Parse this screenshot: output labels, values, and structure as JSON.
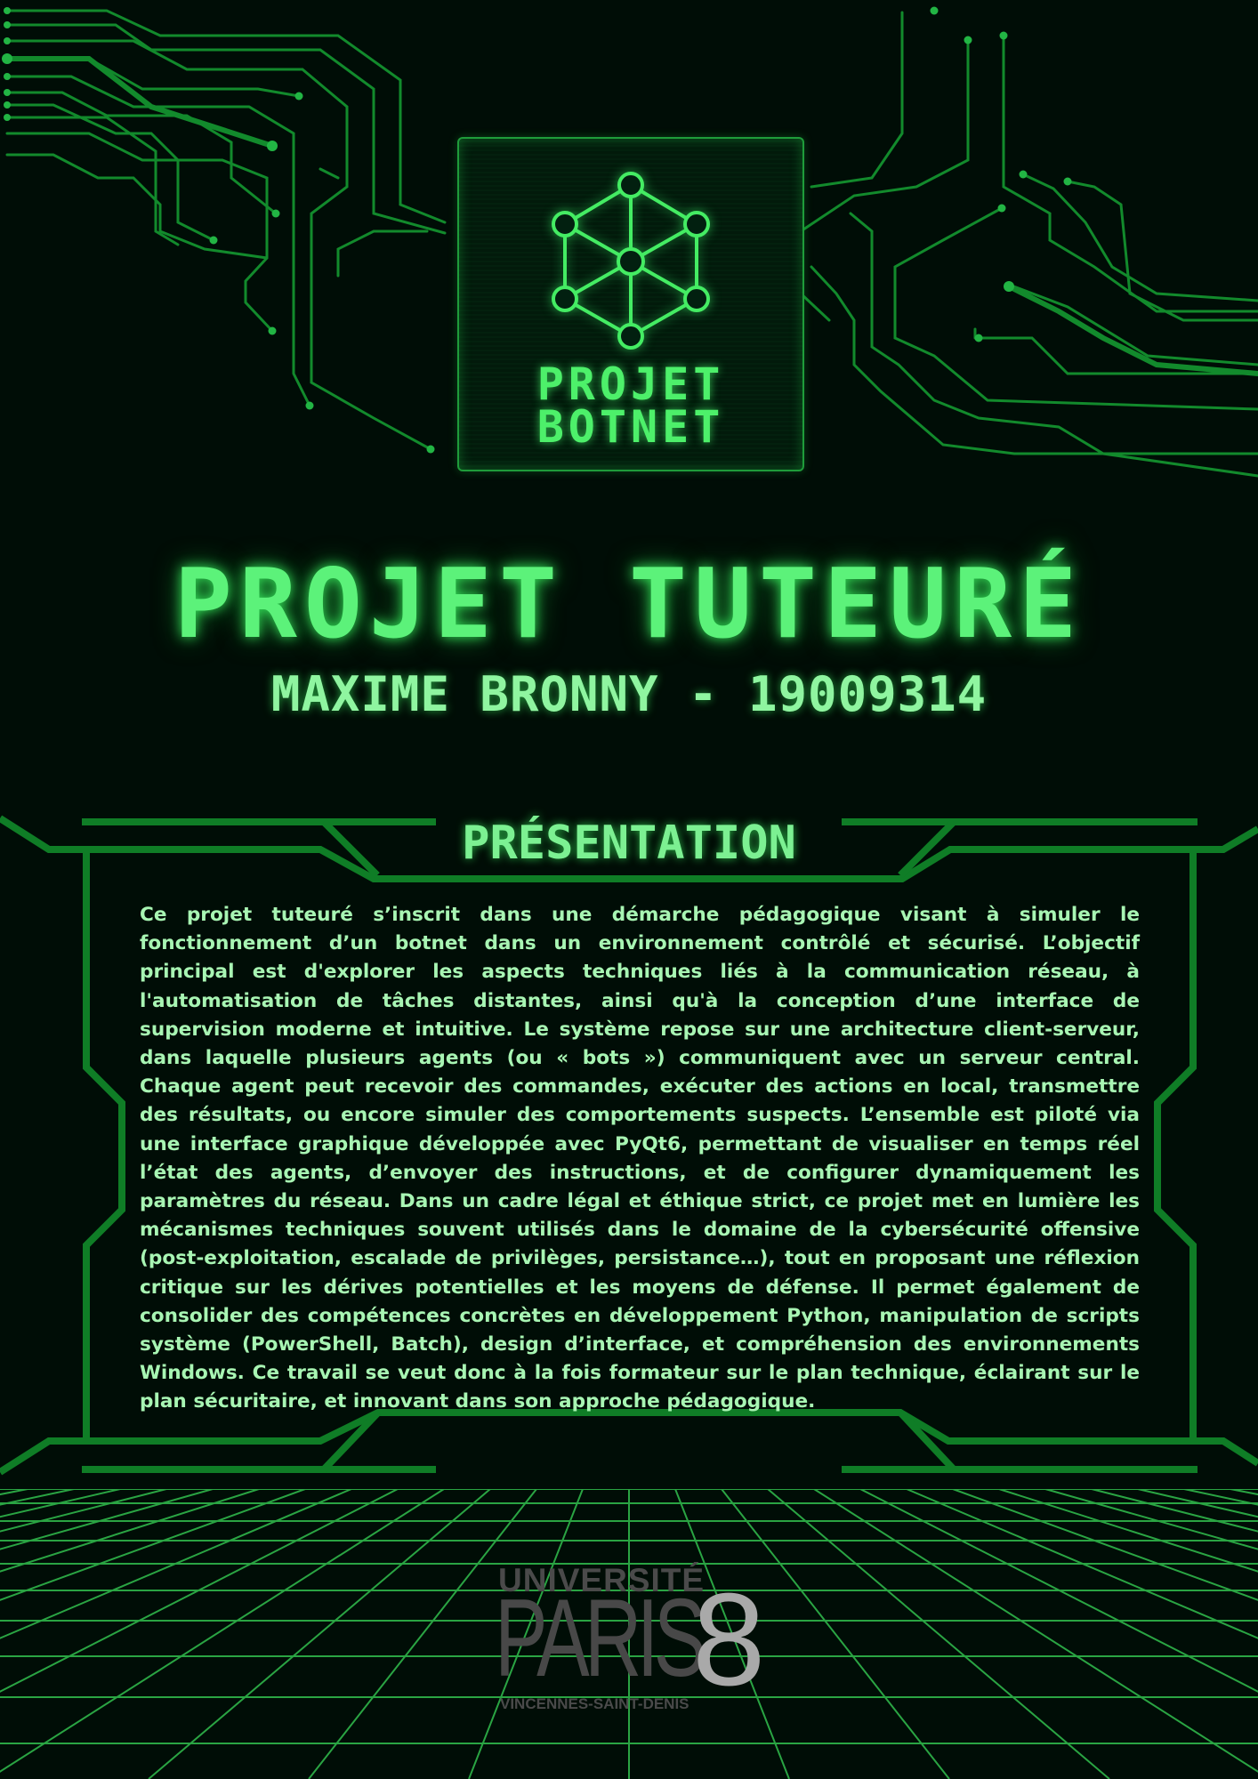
{
  "colors": {
    "background": "#000d06",
    "circuit": "#128a2c",
    "neon": "#5cf27a",
    "text": "#a8f5b3",
    "grid": "#2fb54a",
    "logo_gray": "#484848",
    "logo_light": "#a9a9a9"
  },
  "logo": {
    "icon": "network-hexagon-icon",
    "line1": "PROJET",
    "line2": "BOTNET"
  },
  "header": {
    "title": "PROJET TUTEURÉ",
    "subtitle": "MAXIME BRONNY - 19009314"
  },
  "presentation": {
    "heading": "PRÉSENTATION",
    "body": "Ce projet tuteuré s’inscrit dans une démarche pédagogique visant à simuler le fonctionnement d’un botnet dans un environnement contrôlé et sécurisé. L’objectif principal est d'explorer les aspects techniques liés à la communication réseau, à l'automatisation de tâches distantes, ainsi qu'à la conception d’une interface de supervision moderne et intuitive. Le système repose sur une architecture client-serveur, dans laquelle plusieurs agents (ou « bots ») communiquent avec un serveur central. Chaque agent peut recevoir des commandes, exécuter des actions en local, transmettre des résultats, ou encore simuler des comportements suspects. L’ensemble est piloté via une interface graphique développée avec PyQt6, permettant de visualiser en temps réel l’état des agents, d’envoyer des instructions, et de configurer dynamiquement les paramètres du réseau. Dans un cadre légal et éthique strict, ce projet met en lumière les mécanismes techniques souvent utilisés dans le domaine de la cybersécurité offensive (post-exploitation, escalade de privilèges, persistance…), tout en proposant une réflexion critique sur les dérives potentielles et les moyens de défense. Il permet également de consolider des compétences concrètes en développement Python, manipulation de scripts système (PowerShell, Batch), design d’interface, et compréhension des environnements Windows. Ce travail se veut donc à la fois formateur sur le plan technique, éclairant sur le plan sécuritaire, et innovant dans son approche pédagogique."
  },
  "university": {
    "top": "UNIVERSITÉ",
    "main": "PARIS",
    "number": "8",
    "bottom": "VINCENNES-SAINT-DENIS"
  }
}
